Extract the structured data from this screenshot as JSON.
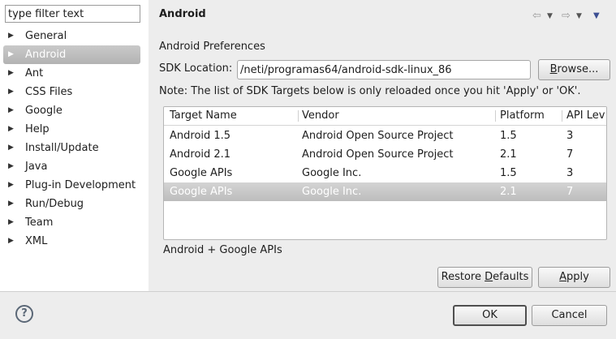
{
  "filter": {
    "placeholder": "type filter text"
  },
  "tree": {
    "items": [
      {
        "label": "General",
        "selected": false
      },
      {
        "label": "Android",
        "selected": true
      },
      {
        "label": "Ant",
        "selected": false
      },
      {
        "label": "CSS Files",
        "selected": false
      },
      {
        "label": "Google",
        "selected": false
      },
      {
        "label": "Help",
        "selected": false
      },
      {
        "label": "Install/Update",
        "selected": false
      },
      {
        "label": "Java",
        "selected": false
      },
      {
        "label": "Plug-in Development",
        "selected": false
      },
      {
        "label": "Run/Debug",
        "selected": false
      },
      {
        "label": "Team",
        "selected": false
      },
      {
        "label": "XML",
        "selected": false
      }
    ]
  },
  "page": {
    "title": "Android",
    "heading": "Android Preferences",
    "sdk_label": "SDK Location:",
    "sdk_value": "/neti/programas64/android-sdk-linux_86",
    "browse_label_pre": "",
    "browse_label_mn": "B",
    "browse_label_post": "rowse...",
    "note": "Note: The list of SDK Targets below is only reloaded once you hit 'Apply' or 'OK'.",
    "selected_target": "Android + Google APIs"
  },
  "nav_icons": {
    "back": "back-arrow-icon",
    "forward": "forward-arrow-icon",
    "menu": "view-menu-icon"
  },
  "table": {
    "columns": [
      "Target Name",
      "Vendor",
      "Platform",
      "API Lev"
    ],
    "rows": [
      {
        "name": "Android 1.5",
        "vendor": "Android Open Source Project",
        "platform": "1.5",
        "api": "3",
        "selected": false
      },
      {
        "name": "Android 2.1",
        "vendor": "Android Open Source Project",
        "platform": "2.1",
        "api": "7",
        "selected": false
      },
      {
        "name": "Google APIs",
        "vendor": "Google Inc.",
        "platform": "1.5",
        "api": "3",
        "selected": false
      },
      {
        "name": "Google APIs",
        "vendor": "Google Inc.",
        "platform": "2.1",
        "api": "7",
        "selected": true
      }
    ]
  },
  "buttons": {
    "restore_pre": "Restore ",
    "restore_mn": "D",
    "restore_post": "efaults",
    "apply_pre": "",
    "apply_mn": "A",
    "apply_post": "pply",
    "ok": "OK",
    "cancel": "Cancel"
  },
  "help": {
    "icon": "help-icon",
    "glyph": "?"
  },
  "colors": {
    "selection": "#b9b9b9",
    "panel_bg": "#ededed",
    "menu_accent": "#3c4f93"
  }
}
